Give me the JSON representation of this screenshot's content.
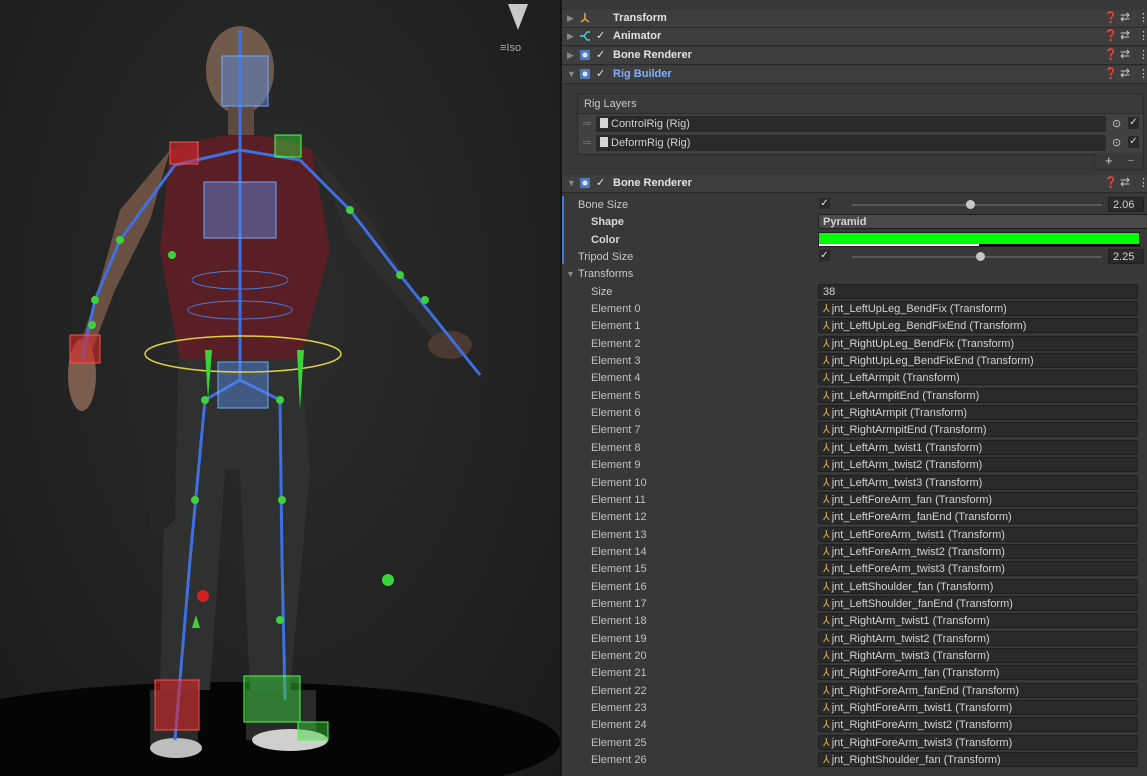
{
  "scene": {
    "iso_label": "Iso"
  },
  "components": [
    {
      "title": "Transform",
      "expanded": false,
      "checkbox": false
    },
    {
      "title": "Animator",
      "expanded": false,
      "checkbox": true
    },
    {
      "title": "Bone Renderer",
      "expanded": false,
      "checkbox": true
    },
    {
      "title": "Rig Builder",
      "expanded": true,
      "checkbox": true,
      "highlight": true
    }
  ],
  "rig_builder": {
    "rig_layers_label": "Rig Layers",
    "layers": [
      "ControlRig (Rig)",
      "DeformRig (Rig)"
    ],
    "add_label": "+",
    "remove_label": "−"
  },
  "bone_renderer": {
    "title": "Bone Renderer",
    "bone_size_label": "Bone Size",
    "bone_size_value": "2.06",
    "bone_size_fraction": 0.47,
    "shape_label": "Shape",
    "shape_value": "Pyramid",
    "color_label": "Color",
    "color_hex": "#00ff00",
    "tripod_size_label": "Tripod Size",
    "tripod_size_value": "2.25",
    "tripod_size_fraction": 0.51,
    "transforms_label": "Transforms",
    "size_label": "Size",
    "size_value": "38",
    "elements": [
      {
        "label": "Element 0",
        "value": "jnt_LeftUpLeg_BendFix (Transform)"
      },
      {
        "label": "Element 1",
        "value": "jnt_LeftUpLeg_BendFixEnd (Transform)"
      },
      {
        "label": "Element 2",
        "value": "jnt_RightUpLeg_BendFix (Transform)"
      },
      {
        "label": "Element 3",
        "value": "jnt_RightUpLeg_BendFixEnd (Transform)"
      },
      {
        "label": "Element 4",
        "value": "jnt_LeftArmpit (Transform)"
      },
      {
        "label": "Element 5",
        "value": "jnt_LeftArmpitEnd (Transform)"
      },
      {
        "label": "Element 6",
        "value": "jnt_RightArmpit (Transform)"
      },
      {
        "label": "Element 7",
        "value": "jnt_RightArmpitEnd (Transform)"
      },
      {
        "label": "Element 8",
        "value": "jnt_LeftArm_twist1 (Transform)"
      },
      {
        "label": "Element 9",
        "value": "jnt_LeftArm_twist2 (Transform)"
      },
      {
        "label": "Element 10",
        "value": "jnt_LeftArm_twist3 (Transform)"
      },
      {
        "label": "Element 11",
        "value": "jnt_LeftForeArm_fan (Transform)"
      },
      {
        "label": "Element 12",
        "value": "jnt_LeftForeArm_fanEnd (Transform)"
      },
      {
        "label": "Element 13",
        "value": "jnt_LeftForeArm_twist1 (Transform)"
      },
      {
        "label": "Element 14",
        "value": "jnt_LeftForeArm_twist2 (Transform)"
      },
      {
        "label": "Element 15",
        "value": "jnt_LeftForeArm_twist3 (Transform)"
      },
      {
        "label": "Element 16",
        "value": "jnt_LeftShoulder_fan (Transform)"
      },
      {
        "label": "Element 17",
        "value": "jnt_LeftShoulder_fanEnd (Transform)"
      },
      {
        "label": "Element 18",
        "value": "jnt_RightArm_twist1 (Transform)"
      },
      {
        "label": "Element 19",
        "value": "jnt_RightArm_twist2 (Transform)"
      },
      {
        "label": "Element 20",
        "value": "jnt_RightArm_twist3 (Transform)"
      },
      {
        "label": "Element 21",
        "value": "jnt_RightForeArm_fan (Transform)"
      },
      {
        "label": "Element 22",
        "value": "jnt_RightForeArm_fanEnd (Transform)"
      },
      {
        "label": "Element 23",
        "value": "jnt_RightForeArm_twist1 (Transform)"
      },
      {
        "label": "Element 24",
        "value": "jnt_RightForeArm_twist2 (Transform)"
      },
      {
        "label": "Element 25",
        "value": "jnt_RightForeArm_twist3 (Transform)"
      },
      {
        "label": "Element 26",
        "value": "jnt_RightShoulder_fan (Transform)"
      }
    ]
  },
  "icons": {
    "help": "question-circle-icon",
    "preset": "preset-sliders-icon",
    "menu": "kebab-menu-icon",
    "transform_ref": "transform-axes-icon"
  }
}
